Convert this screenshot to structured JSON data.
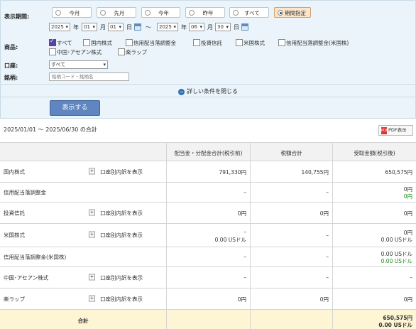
{
  "filter": {
    "period_label": "表示期間:",
    "period_buttons": [
      "今月",
      "先月",
      "今年",
      "昨年",
      "すべて",
      "期間指定"
    ],
    "selected_period": "期間指定",
    "from": {
      "year": "2025",
      "month": "01",
      "day": "01"
    },
    "to": {
      "year": "2025",
      "month": "06",
      "day": "30"
    },
    "unit_year": "年",
    "unit_month": "月",
    "unit_day": "日",
    "range_sep": "～",
    "product_label": "商品:",
    "products": [
      {
        "label": "すべて",
        "checked": true
      },
      {
        "label": "国内株式",
        "checked": false
      },
      {
        "label": "信用配当落調整金",
        "checked": false
      },
      {
        "label": "投資信託",
        "checked": false
      },
      {
        "label": "米国株式",
        "checked": false
      },
      {
        "label": "信用配当落調整金(米国株)",
        "checked": false
      },
      {
        "label": "中国･アセアン株式",
        "checked": false
      },
      {
        "label": "楽ラップ",
        "checked": false
      }
    ],
    "account_label": "口座:",
    "account_value": "すべて",
    "symbol_label": "銘柄:",
    "symbol_placeholder": "銘柄コード・銘柄名",
    "toggle_label": "詳しい条件を閉じる",
    "submit_label": "表示する"
  },
  "summary": {
    "period_text": "2025/01/01 ～ 2025/06/30 の合計",
    "pdf_label": "PDF表示"
  },
  "table": {
    "headers": [
      "配当金・分配金合計(税引前)",
      "税額合計",
      "受取金額(税引後)"
    ],
    "breakdown_label": "口座別内訳を表示",
    "rows": [
      {
        "name": "国内株式",
        "breakdown": true,
        "gross": [
          "791,330円"
        ],
        "tax": [
          "140,755円"
        ],
        "net": [
          "650,575円"
        ],
        "net_green": []
      },
      {
        "name": "信用配当落調整金",
        "breakdown": false,
        "gross": [
          "–"
        ],
        "tax": [
          "–"
        ],
        "net": [
          "0円"
        ],
        "net_green": [
          "0円"
        ]
      },
      {
        "name": "投資信託",
        "breakdown": true,
        "gross": [
          "0円"
        ],
        "tax": [
          "0円"
        ],
        "net": [
          "0円"
        ],
        "net_green": []
      },
      {
        "name": "米国株式",
        "breakdown": true,
        "gross": [
          "–",
          "0.00 USドル"
        ],
        "tax": [
          "–"
        ],
        "net": [
          "0円",
          "0.00 USドル"
        ],
        "net_green": []
      },
      {
        "name": "信用配当落調整金(米国株)",
        "breakdown": false,
        "gross": [
          "–"
        ],
        "tax": [
          "–"
        ],
        "net": [
          "0.00 USドル"
        ],
        "net_green": [
          "0.00 USドル"
        ]
      },
      {
        "name": "中国･アセアン株式",
        "breakdown": true,
        "gross": [
          "–"
        ],
        "tax": [
          "–"
        ],
        "net": [
          "–"
        ],
        "net_green": []
      },
      {
        "name": "楽ラップ",
        "breakdown": true,
        "gross": [
          "0円"
        ],
        "tax": [
          "0円"
        ],
        "net": [
          "0円"
        ],
        "net_green": []
      }
    ],
    "total": {
      "label": "合計",
      "net": [
        "650,575円",
        "0.00 USドル"
      ]
    }
  }
}
